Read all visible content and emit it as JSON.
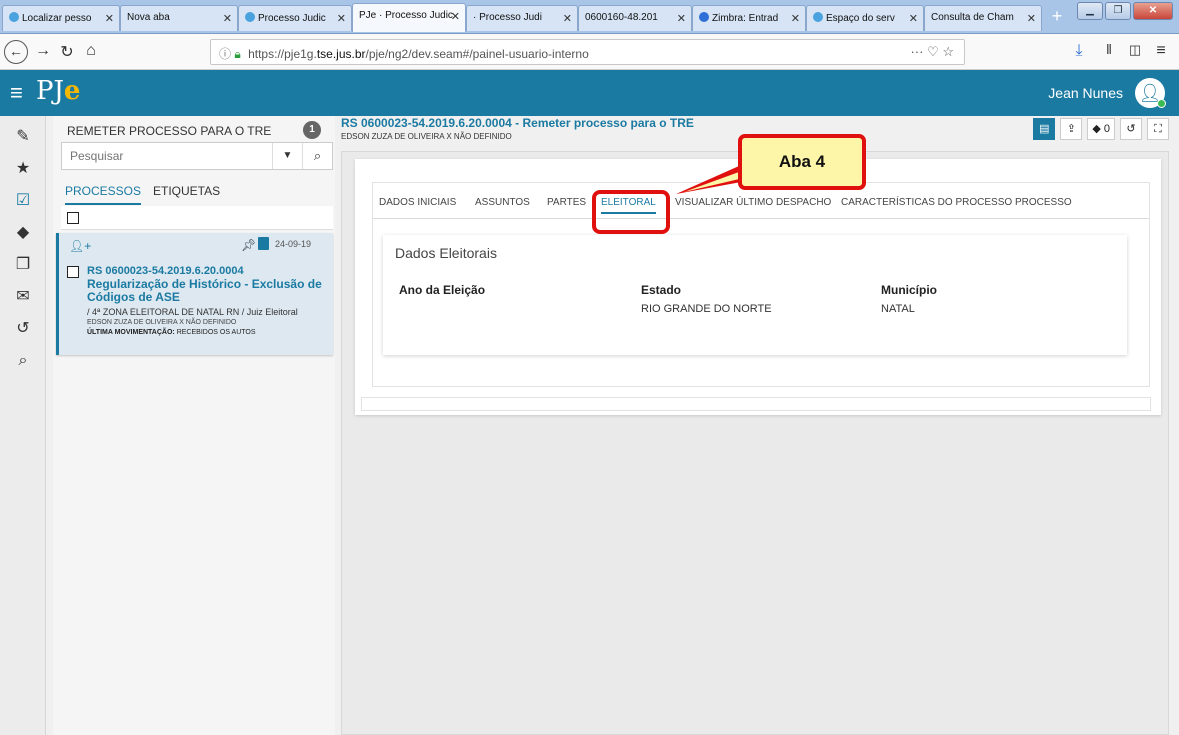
{
  "browser": {
    "tabs": [
      {
        "label": "Localizar pesso",
        "fav": "#4aa3df"
      },
      {
        "label": "Nova aba",
        "fav": ""
      },
      {
        "label": "Processo Judic",
        "fav": "#4aa3df"
      },
      {
        "label": "PJe · Processo Judic",
        "fav": "#1b7aa2"
      },
      {
        "label": "· Processo Judi",
        "fav": "#e07a1f"
      },
      {
        "label": "0600160-48.201",
        "fav": "#e07a1f"
      },
      {
        "label": "Zimbra: Entrad",
        "fav": "#2f6fd6"
      },
      {
        "label": "Espaço do serv",
        "fav": "#4aa3df"
      },
      {
        "label": "Consulta de Cham",
        "fav": ""
      }
    ],
    "url_prefix": "https://pje1g.",
    "url_domain": "tse.jus.br",
    "url_rest": "/pje/ng2/dev.seam#/painel-usuario-interno",
    "url_actions": "··· ♡ ☆"
  },
  "header": {
    "logo": "PJ",
    "logo_accent": "e",
    "user": "Jean Nunes"
  },
  "sidebar": {
    "title": "REMETER PROCESSO PARA O TRE",
    "badge": "1",
    "search_placeholder": "Pesquisar",
    "tabs": [
      "PROCESSOS",
      "ETIQUETAS"
    ],
    "card": {
      "date": "24-09-19",
      "number": "RS 0600023-54.2019.6.20.0004",
      "subject": "Regularização de Histórico - Exclusão de Códigos de ASE",
      "zone": "/ 4ª ZONA ELEITORAL DE NATAL RN / Juiz Eleitoral",
      "parties": "EDSON ZUZA DE OLIVEIRA X NÃO DEFINIDO",
      "movement_label": "ÚLTIMA MOVIMENTAÇÃO:",
      "movement_value": "RECEBIDOS OS AUTOS"
    }
  },
  "main": {
    "title": "RS 0600023-54.2019.6.20.0004 - Remeter processo para o TRE",
    "parties": "EDSON ZUZA DE OLIVEIRA X NÃO DEFINIDO",
    "toolbar": {
      "tags_count": "0"
    },
    "tabs": [
      "DADOS INICIAIS",
      "ASSUNTOS",
      "PARTES",
      "ELEITORAL",
      "VISUALIZAR ÚLTIMO DESPACHO",
      "CARACTERÍSTICAS DO PROCESSO",
      "PROCESSO"
    ],
    "section_title": "Dados Eleitorais",
    "fields": [
      {
        "label": "Ano da Eleição",
        "value": ""
      },
      {
        "label": "Estado",
        "value": "RIO GRANDE DO NORTE"
      },
      {
        "label": "Município",
        "value": "NATAL"
      }
    ]
  },
  "annotation": {
    "callout": "Aba 4"
  },
  "colors": {
    "brand": "#1b7aa2",
    "accent": "#f5b800",
    "highlight": "#e0100f",
    "callout_bg": "#fdf6a9"
  }
}
